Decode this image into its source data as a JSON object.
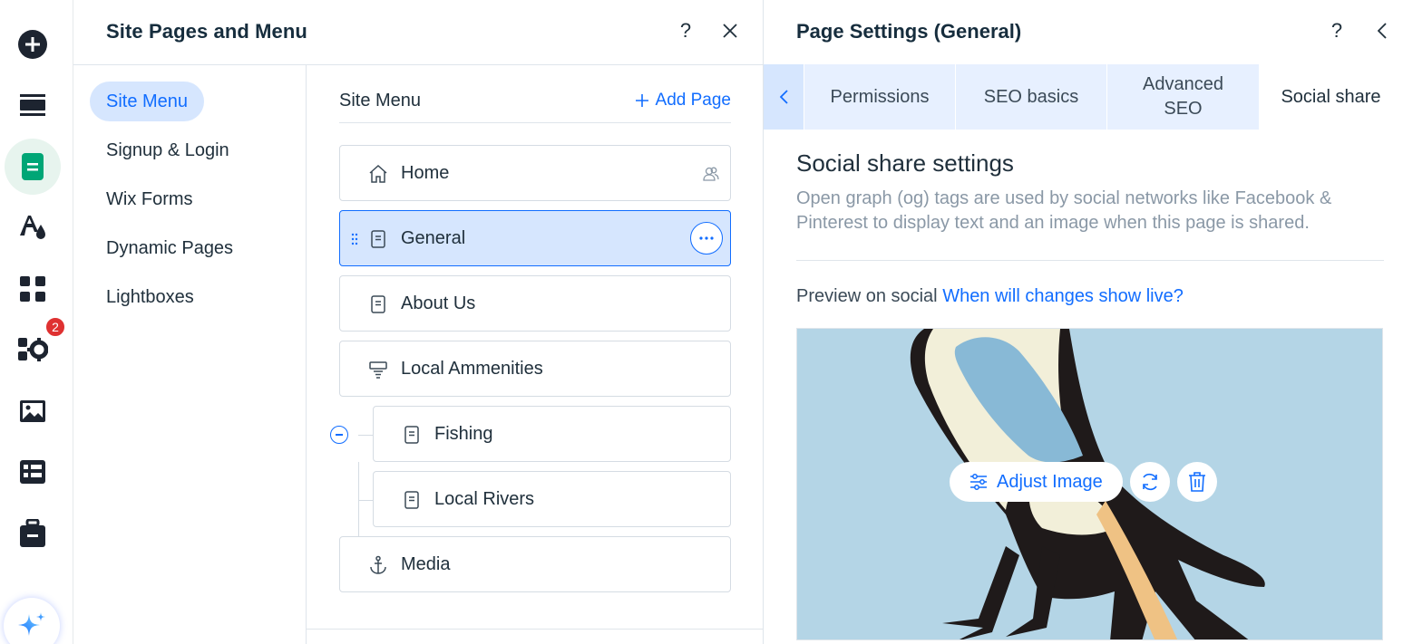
{
  "rail": {
    "items": [
      {
        "name": "add-icon"
      },
      {
        "name": "layout-icon"
      },
      {
        "name": "pages-icon"
      },
      {
        "name": "design-icon"
      },
      {
        "name": "apps-icon"
      },
      {
        "name": "app-market-icon"
      },
      {
        "name": "media-icon"
      },
      {
        "name": "cms-icon"
      },
      {
        "name": "business-icon"
      },
      {
        "name": "ai-assistant-icon"
      }
    ],
    "notification_count": "2",
    "active_color": "#00a676"
  },
  "pages_panel": {
    "title": "Site Pages and Menu",
    "help_label": "?",
    "close_label": "✕",
    "categories": [
      {
        "label": "Site Menu"
      },
      {
        "label": "Signup & Login"
      },
      {
        "label": "Wix Forms"
      },
      {
        "label": "Dynamic Pages"
      },
      {
        "label": "Lightboxes"
      }
    ],
    "menu": {
      "title": "Site Menu",
      "add_page_label": "Add Page",
      "pages": [
        {
          "label": "Home"
        },
        {
          "label": "General"
        },
        {
          "label": "About Us"
        },
        {
          "label": "Local Ammenities"
        },
        {
          "label": "Fishing"
        },
        {
          "label": "Local Rivers"
        },
        {
          "label": "Media"
        }
      ]
    }
  },
  "settings_panel": {
    "title": "Page Settings (General)",
    "help_label": "?",
    "tabs": [
      {
        "label": "Permissions"
      },
      {
        "label": "SEO basics"
      },
      {
        "label": "Advanced SEO"
      },
      {
        "label": "Social share"
      }
    ],
    "section_title": "Social share settings",
    "section_desc": "Open graph (og) tags are used by social networks like Facebook & Pinterest to display text and an image when this page is shared.",
    "preview_label": "Preview on social",
    "preview_link": "When will changes show live?",
    "adjust_image_label": "Adjust Image"
  },
  "colors": {
    "accent": "#116dff",
    "selected_bg": "#d6e6fe",
    "badge": "#df3131"
  }
}
